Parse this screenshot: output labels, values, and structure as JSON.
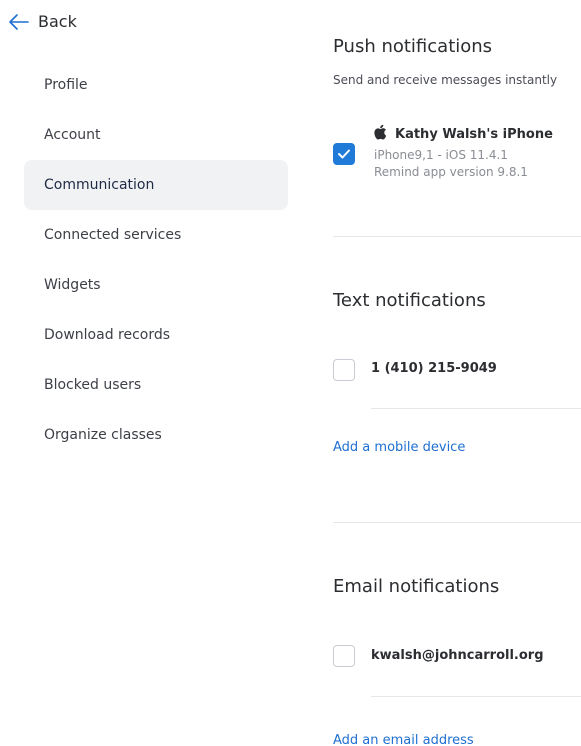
{
  "nav": {
    "back_label": "Back",
    "items": [
      {
        "label": "Profile"
      },
      {
        "label": "Account"
      },
      {
        "label": "Communication"
      },
      {
        "label": "Connected services"
      },
      {
        "label": "Widgets"
      },
      {
        "label": "Download records"
      },
      {
        "label": "Blocked users"
      },
      {
        "label": "Organize classes"
      }
    ],
    "active": "Communication"
  },
  "push": {
    "title": "Push notifications",
    "description": "Send and receive messages instantly",
    "device": {
      "checked": true,
      "name": "Kathy Walsh's iPhone",
      "model": "iPhone9,1 - iOS 11.4.1",
      "app_version": "Remind app version 9.8.1"
    }
  },
  "text": {
    "title": "Text notifications",
    "phone": {
      "checked": false,
      "value": "1 (410) 215-9049"
    },
    "add_link": "Add a mobile device"
  },
  "email": {
    "title": "Email notifications",
    "address": {
      "checked": false,
      "value": "kwalsh@johncarroll.org"
    },
    "add_link": "Add an email address"
  },
  "colors": {
    "accent": "#1f7ad8",
    "link": "#1f6fd1",
    "active_bg": "#f1f2f4"
  },
  "icons": {
    "back": "arrow-left-icon",
    "device": "apple-icon",
    "check": "checkmark-icon"
  }
}
